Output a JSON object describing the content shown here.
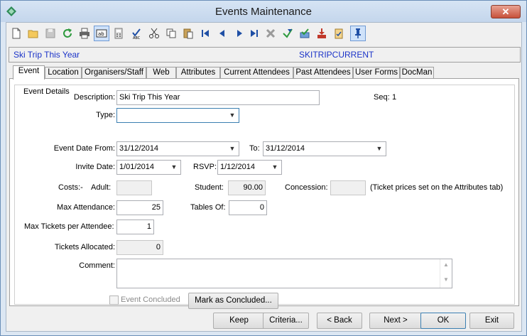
{
  "window": {
    "title": "Events Maintenance",
    "close_label": "✕"
  },
  "toolbar": {
    "buttons": [
      "new-icon",
      "open-icon",
      "save-icon",
      "refresh-icon",
      "print-icon",
      "text-field-icon",
      "calculator-icon",
      "spellcheck-icon",
      "cut-icon",
      "copy-icon",
      "paste-icon",
      "first-record-icon",
      "previous-record-icon",
      "next-record-icon",
      "last-record-icon",
      "delete-icon",
      "send-icon",
      "approve-icon",
      "download-icon",
      "clipboard-check-icon",
      "pin-icon"
    ]
  },
  "header": {
    "event_name": "Ski Trip This Year",
    "event_code": "SKITRIPCURRENT"
  },
  "tabs": [
    "Event",
    "Location",
    "Organisers/Staff",
    "Web",
    "Attributes",
    "Current Attendees",
    "Past Attendees",
    "User Forms",
    "DocMan"
  ],
  "event_details": {
    "group_label": "Event Details",
    "description_label": "Description:",
    "description_value": "Ski Trip This Year",
    "seq_label": "Seq:",
    "seq_value": "1",
    "type_label": "Type:",
    "type_value": "",
    "date_from_label": "Event Date From:",
    "date_from_value": "31/12/2014",
    "to_label": "To:",
    "to_value": "31/12/2014",
    "invite_label": "Invite Date:",
    "invite_value": "1/01/2014",
    "rsvp_label": "RSVP:",
    "rsvp_value": "1/12/2014",
    "costs_label": "Costs:-",
    "adult_label": "Adult:",
    "adult_value": "",
    "student_label": "Student:",
    "student_value": "90.00",
    "concession_label": "Concession:",
    "concession_value": "",
    "ticket_note": "(Ticket prices set on the Attributes tab)",
    "max_attendance_label": "Max Attendance:",
    "max_attendance_value": "25",
    "tables_of_label": "Tables Of:",
    "tables_of_value": "0",
    "max_tickets_label": "Max Tickets per Attendee:",
    "max_tickets_value": "1",
    "tickets_allocated_label": "Tickets Allocated:",
    "tickets_allocated_value": "0",
    "comment_label": "Comment:",
    "comment_value": "",
    "event_concluded_label": "Event Concluded",
    "mark_concluded_label": "Mark as Concluded..."
  },
  "footer": {
    "keep": "Keep",
    "criteria": "Criteria...",
    "back": "< Back",
    "next": "Next >",
    "ok": "OK",
    "exit": "Exit"
  }
}
